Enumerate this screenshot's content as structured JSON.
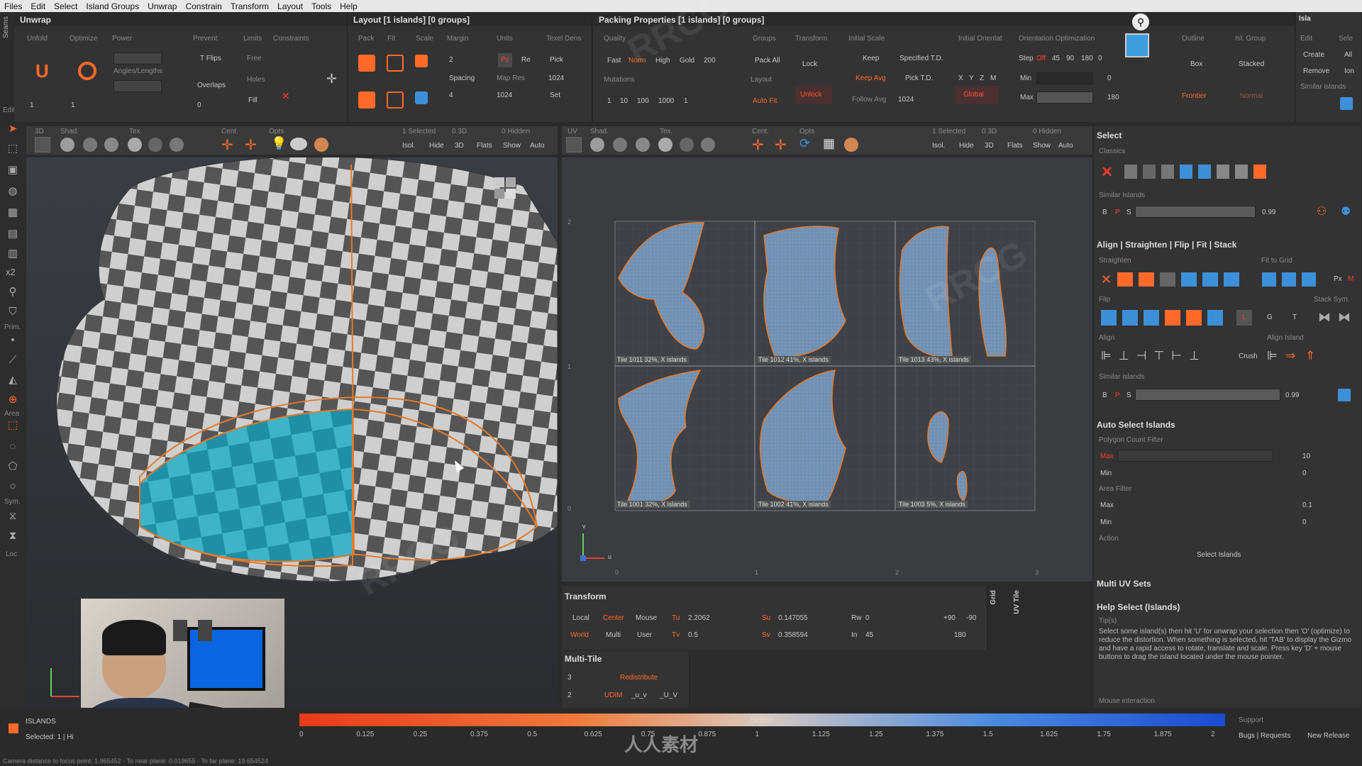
{
  "menubar": [
    "Files",
    "Edit",
    "Select",
    "Island Groups",
    "Unwrap",
    "Constrain",
    "Transform",
    "Layout",
    "Tools",
    "Help"
  ],
  "unwrap": {
    "title": "Unwrap",
    "tabs": [
      "Unfold",
      "Optimize",
      "Power",
      "Prevent",
      "Limits",
      "Constraints"
    ],
    "tflips": "T Flips",
    "free": "Free",
    "angles_lengths": "Angles/Lengths",
    "overlaps": "Overlaps",
    "holes": "Holes",
    "fill": "Fill",
    "v1": "1",
    "v2": "1",
    "v3": "0"
  },
  "layout": {
    "title": "Layout [1 islands] [0 groups]",
    "tabs": [
      "Pack",
      "Fit",
      "Scale",
      "Margin",
      "Units",
      "Texel Dens"
    ],
    "margin": "2",
    "px": "Px",
    "re": "Re",
    "pick": "Pick",
    "spacing": "Spacing",
    "spacing_val": "4",
    "map_res": "Map Res",
    "map_res_val": "1024",
    "map_res_val2": "1024",
    "set": "Set"
  },
  "packing": {
    "title": "Packing Properties [1 islands] [0 groups]",
    "quality": "Quality",
    "quality_opts": [
      "Fast",
      "Norm",
      "High",
      "Gold",
      "200"
    ],
    "groups": "Groups",
    "pack_all": "Pack All",
    "transform": "Transform",
    "lock": "Lock",
    "unlock": "Unlock",
    "initial_scale": "Initial Scale",
    "keep": "Keep",
    "keep_avg": "Keep Avg",
    "specified_td": "Specified T.D.",
    "pick_td": "Pick T.D.",
    "follow_avg": "Follow Avg",
    "follow_val": "1024",
    "initial_orient": "Initial Orientat",
    "xyzm": [
      "X",
      "Y",
      "Z",
      "M"
    ],
    "global": "Global",
    "layout": "Layout",
    "auto_fit": "Auto Fit",
    "mutations": "Mutations",
    "mutation_vals": [
      "1",
      "10",
      "100",
      "1000",
      "1"
    ],
    "orient_opt": "Orientation Optimization",
    "step": "Step",
    "off": "Off",
    "step_vals": [
      "45",
      "90",
      "180",
      "0"
    ],
    "min": "Min",
    "min_val": "0",
    "max": "Max",
    "max_val": "180",
    "outline": "Outline",
    "box": "Box",
    "frontier": "Frontier",
    "isl_group": "Isl. Group",
    "stacked": "Stacked",
    "normal": "Normal"
  },
  "islands_mini": {
    "title": "Isla",
    "edit": "Edit",
    "sele": "Sele",
    "create": "Create",
    "all": "All",
    "remove": "Remove",
    "ion": "Ion",
    "similar": "Similar islands"
  },
  "viewport3d": {
    "tabs": [
      "Edit",
      "3D",
      "Shad.",
      "Tex.",
      "Cent.",
      "Opts"
    ],
    "selected": "1 Selected",
    "count": "0 3D",
    "hidden": "0 Hidden",
    "btns": [
      "Isol.",
      "Hide",
      "3D",
      "Flats",
      "Show",
      "Auto"
    ]
  },
  "uvview": {
    "tabs": [
      "UV",
      "Shad.",
      "Tex.",
      "Cent.",
      "Opts"
    ],
    "selected": "1 Selected",
    "count": "0 3D",
    "hidden": "0 Hidden",
    "btns": [
      "Isol.",
      "Hide",
      "3D",
      "Flats",
      "Show",
      "Auto"
    ],
    "tiles": [
      "Tile 1011 32%, X islands",
      "Tile 1012 41%, X islands",
      "Tile 1013 43%, X islands",
      "Tile 1001 32%, X islands",
      "Tile 1002 41%, X islands",
      "Tile 1003 5%, X islands"
    ],
    "axis_u": "u",
    "axis_v": "v",
    "ruler": [
      "0",
      "1",
      "2",
      "3"
    ],
    "vruler": [
      "2",
      "1",
      "0"
    ]
  },
  "select": {
    "title": "Select",
    "classics": "Classics",
    "similar_islands": "Similar Islands",
    "bps": [
      "B",
      "P",
      "S"
    ],
    "similar_val": "0.99"
  },
  "align": {
    "title": "Align | Straighten | Flip | Fit | Stack",
    "straighten": "Straighten",
    "fit_to_grid": "Fit to Grid",
    "px": "Px",
    "m": "M",
    "flip": "Flip",
    "stack_sym": "Stack Sym.",
    "l": "L",
    "g": "G",
    "t": "T",
    "align_lbl": "Align",
    "align_island": "Align Island",
    "crush": "Crush",
    "similar_islands": "Similar islands",
    "bps": [
      "B",
      "P",
      "S"
    ],
    "similar_val": "0.99"
  },
  "auto_select": {
    "title": "Auto Select Islands",
    "poly_filter": "Polygon Count Filter",
    "max": "Max",
    "max_val": "10",
    "min": "Min",
    "min_val": "0",
    "area_filter": "Area Filter",
    "amax": "Max",
    "amax_val": "0.1",
    "amin": "Min",
    "amin_val": "0",
    "action": "Action",
    "select_islands": "Select Islands"
  },
  "multi_uv": {
    "title": "Multi UV Sets"
  },
  "help_select": {
    "title": "Help Select (Islands)",
    "tips": "Tip(s)",
    "text": "Select some island(s) then hit 'U' for unwrap your selection then 'O' (optimize) to reduce the distortion. When something is selected, hit 'TAB' to display the Gizmo and have a rapid access to rotate, translate and scale. Press key 'D' + mouse buttons to drag the island located under the mouse pointer.",
    "mouse_interaction": "Mouse interaction"
  },
  "transform": {
    "title": "Transform",
    "local": "Local",
    "center": "Center",
    "mouse": "Mouse",
    "world": "World",
    "multi": "Multi",
    "user": "User",
    "tu": "Tu",
    "tu_val": "2.2062",
    "tv": "Tv",
    "tv_val": "0.5",
    "su": "Su",
    "su_val": "0.147055",
    "sv": "Sv",
    "sv_val": "0.358594",
    "rw": "Rw",
    "rw_val": "0",
    "in": "In",
    "in_val": "45",
    "p90": "+90",
    "m90": "-90",
    "v180": "180",
    "grid": "Grid",
    "uvtile": "UV Tile"
  },
  "multitile": {
    "title": "Multi-Tile",
    "n1": "3",
    "n2": "2",
    "redistribute": "Redistribute",
    "udim": "UDIM",
    "uv1": "_u_v",
    "uv2": "_U_V"
  },
  "bottom": {
    "islands": "ISLANDS",
    "selected": "Selected: 1 | Hi",
    "stretch": "Stretch",
    "scale": [
      "0",
      "0.125",
      "0.25",
      "0.375",
      "0.5",
      "0.625",
      "0.75",
      "0.875",
      "1",
      "1.125",
      "1.25",
      "1.375",
      "1.5",
      "1.625",
      "1.75",
      "1.875",
      "2"
    ],
    "support": "Support",
    "bugs": "Bugs | Requests",
    "new_release": "New Release",
    "status": "Camera distance to focus point: 1.965452 - To near plane: 0.019655 - To far plane: 19.654524"
  },
  "left_tools": [
    "Seams",
    "Edit",
    "x2",
    "Prim.",
    "Area",
    "Sym.",
    "Loc"
  ],
  "overlay": {
    "watermark": "RRCG",
    "watermark2": "人人素材"
  },
  "colors": {
    "accent": "#ff6a2a",
    "selection": "#2a9fb5",
    "bg": "#333333"
  }
}
